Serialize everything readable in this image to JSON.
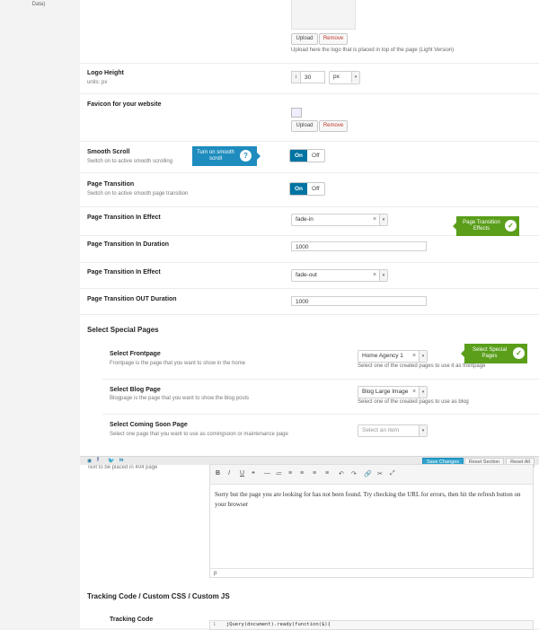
{
  "sidebar": {
    "crumb": "Data)"
  },
  "logo": {
    "upload": "Upload",
    "remove": "Remove",
    "note": "Upload here the logo that is placed in top of the page (Light Version)"
  },
  "logo_height": {
    "title": "Logo Height",
    "desc": "units: px",
    "value": "30",
    "unit": "px"
  },
  "favicon": {
    "title": "Favicon for your website",
    "upload": "Upload",
    "remove": "Remove"
  },
  "smooth_scroll": {
    "title": "Smooth Scroll",
    "desc": "Switch on to active smooth scrolling",
    "on": "On",
    "off": "Off",
    "tooltip": "Turn on smooth scroll",
    "tooltip_icon": "?"
  },
  "page_transition": {
    "title": "Page Transition",
    "desc": "Switch on to active smooth page transition",
    "on": "On",
    "off": "Off"
  },
  "pt_in_effect": {
    "title": "Page Transition In Effect",
    "value": "fade-in",
    "clear": "×",
    "tooltip": "Page Transition Effects"
  },
  "pt_in_duration": {
    "title": "Page Transition In Duration",
    "value": "1000"
  },
  "pt_out_effect": {
    "title": "Page Transition In Effect",
    "value": "fade-out",
    "clear": "×"
  },
  "pt_out_duration": {
    "title": "Page Transition OUT Duration",
    "value": "1000"
  },
  "special_pages": {
    "heading": "Select Special Pages",
    "tooltip": "Select Special Pages",
    "frontpage": {
      "title": "Select Frontpage",
      "desc": "Frontpage is the page that you want to show in the home",
      "value": "Home Agency 1",
      "clear": "×",
      "note": "Select one of the created pages to use it as frontpage"
    },
    "blogpage": {
      "title": "Select Blog Page",
      "desc": "Blogpage is the page that you want to show the blog posts",
      "value": "Blog Large Image",
      "clear": "×",
      "note": "Select one of the created pages to use as blog"
    },
    "comingsoon": {
      "title": "Select Coming Soon Page",
      "desc": "Select one page that you want to use as comingsoon or maintenance page",
      "placeholder": "Select an item"
    }
  },
  "footer": {
    "save": "Save Changes",
    "reset_section": "Reset Section",
    "reset_all": "Reset All"
  },
  "page404": {
    "label": "Text to be placed in 404 page",
    "content": "Sorry but the page you are looking for has not been found. Try checking the URL for errors, then hit the refresh button on your browser",
    "status": "p",
    "toolbar": [
      "B",
      "I",
      "U",
      "❝",
      "—",
      "≔",
      "≡",
      "≡",
      "≡",
      "≡",
      "↶",
      "↷",
      "🔗",
      "✂",
      "⤢"
    ]
  },
  "tracking": {
    "heading": "Tracking Code / Custom CSS / Custom JS",
    "code_title": "Tracking Code",
    "code_line_no": "1",
    "code_line": "jQuery(document).ready(function($){"
  },
  "colors": {
    "primary": "#0074a2",
    "tip_blue": "#1e8cbe",
    "tip_green": "#5a9e1a",
    "remove": "#c0392b"
  }
}
